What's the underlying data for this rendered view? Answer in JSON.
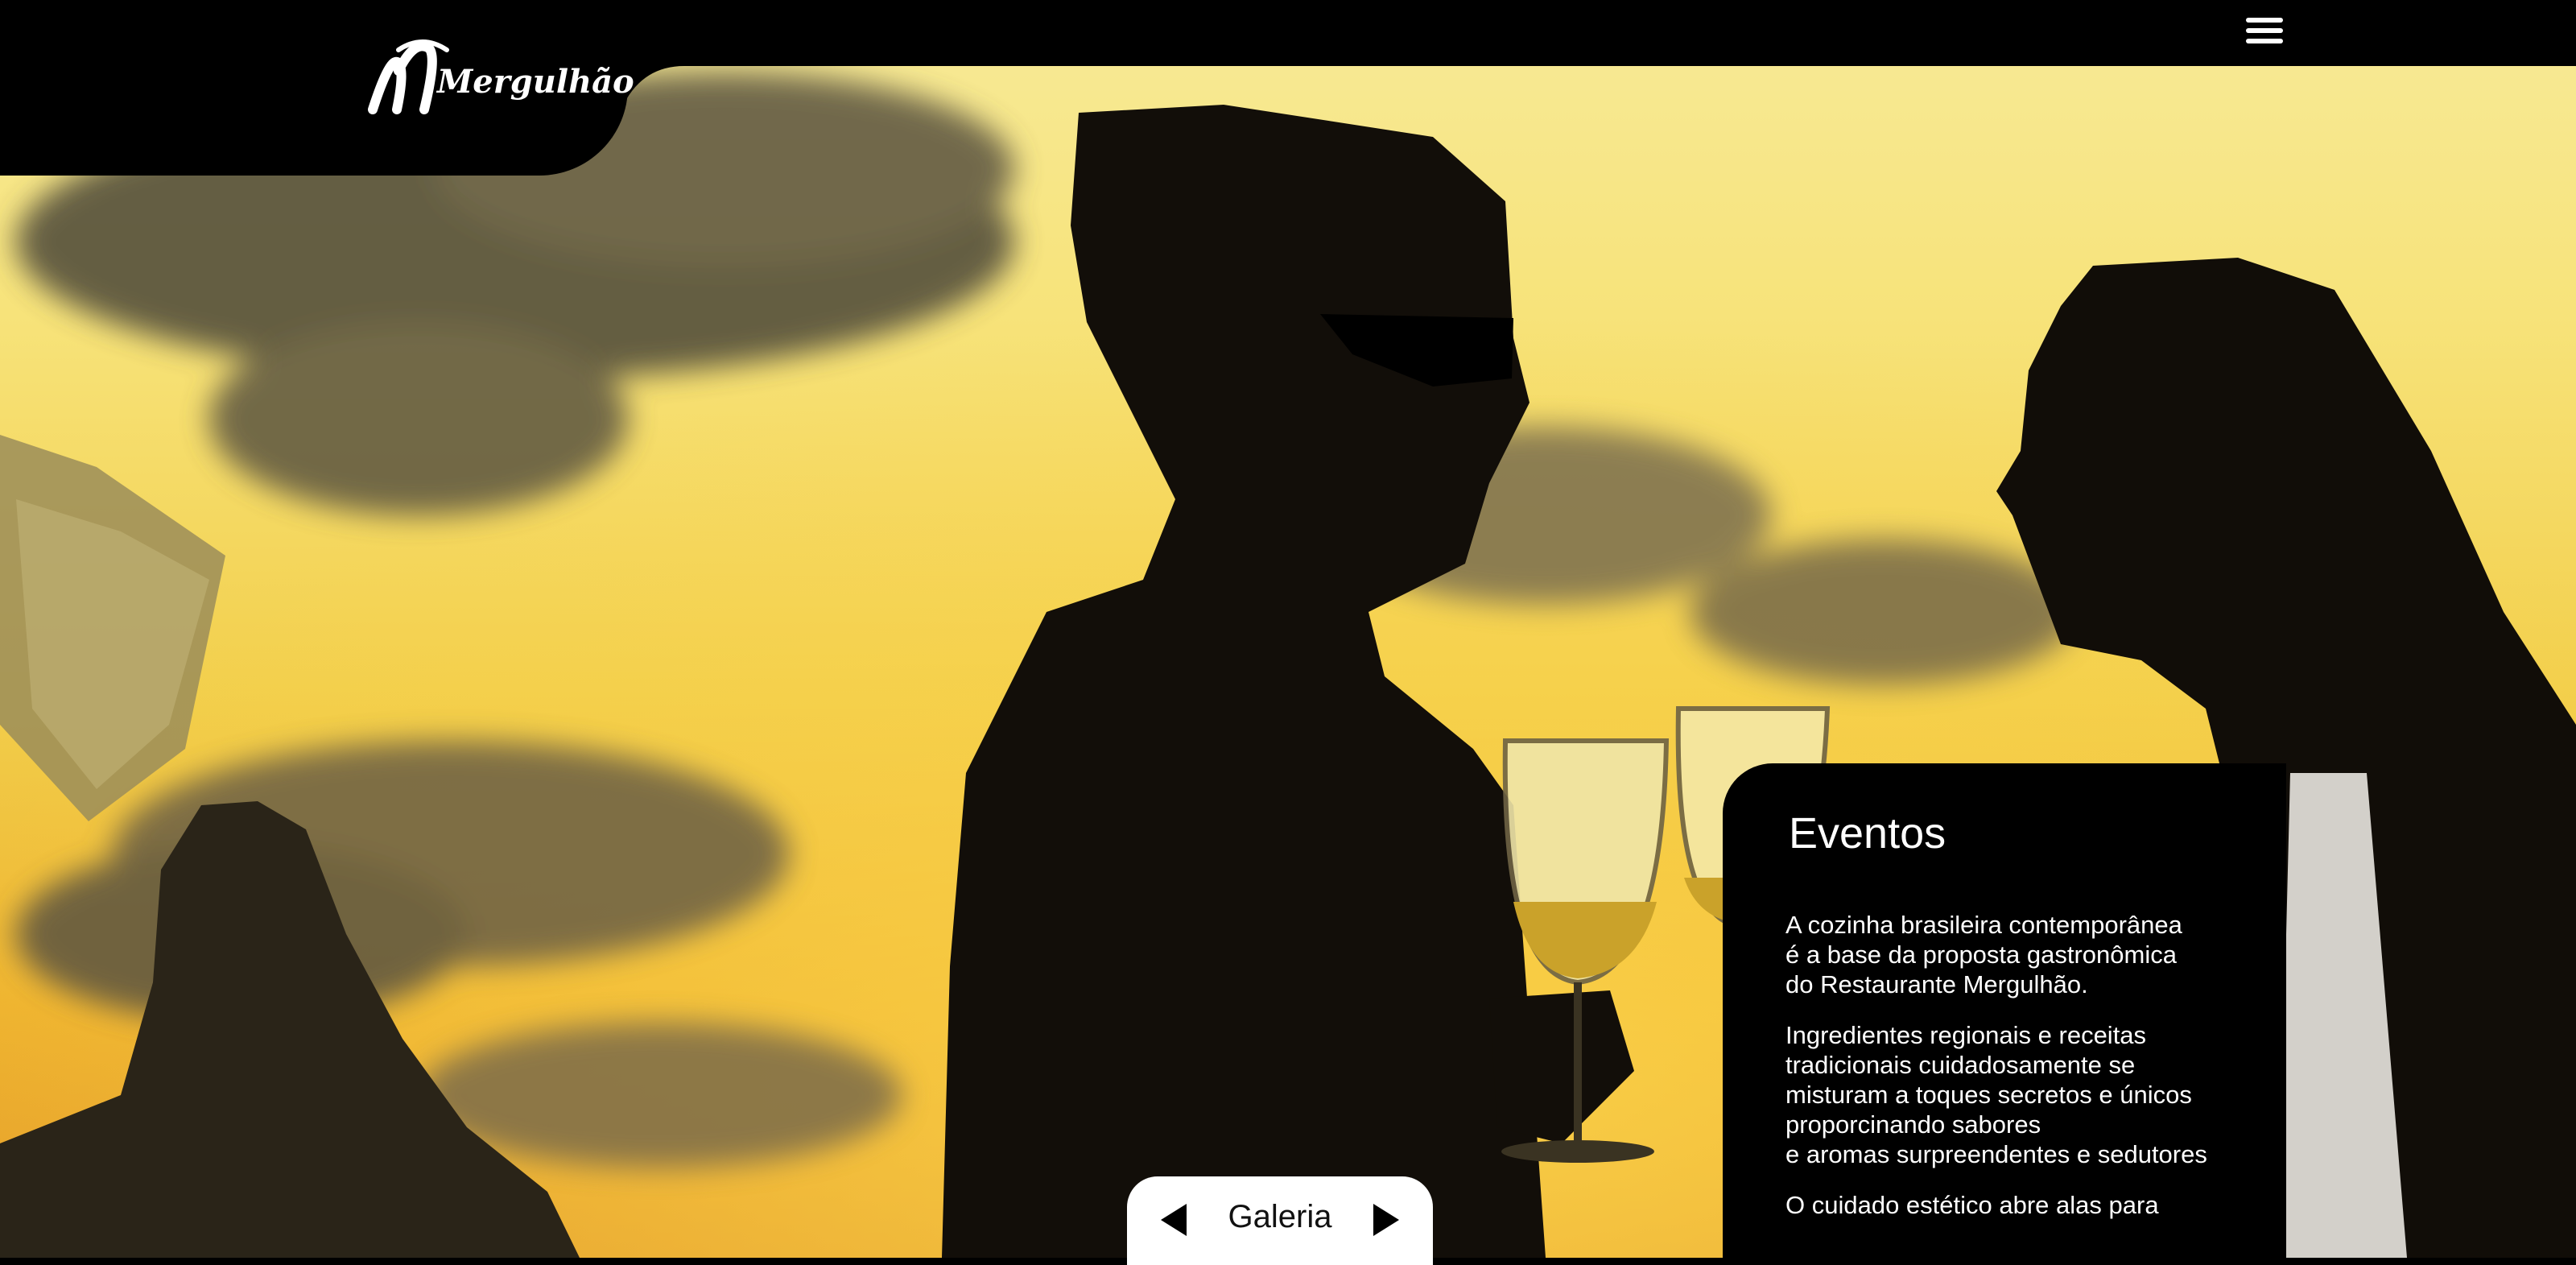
{
  "brand": {
    "name": "Mergulhão"
  },
  "header": {
    "menu_icon": "hamburger-menu-icon"
  },
  "events_card": {
    "title": "Eventos",
    "paragraphs": [
      "A cozinha brasileira contemporânea\né a base da proposta gastronômica\ndo Restaurante Mergulhão.",
      "Ingredientes regionais e receitas\ntradicionais cuidadosamente se\nmisturam a toques secretos e únicos\nproporcinando sabores\ne aromas surpreendentes e sedutores",
      "O cuidado estético abre alas para"
    ]
  },
  "gallery": {
    "label": "Galeria",
    "prev_icon": "triangle-left-icon",
    "next_icon": "triangle-right-icon"
  },
  "colors": {
    "header_bg": "#000000",
    "card_bg": "#000000",
    "sky_top": "#f7ea98",
    "sky_bottom": "#e39a28"
  }
}
